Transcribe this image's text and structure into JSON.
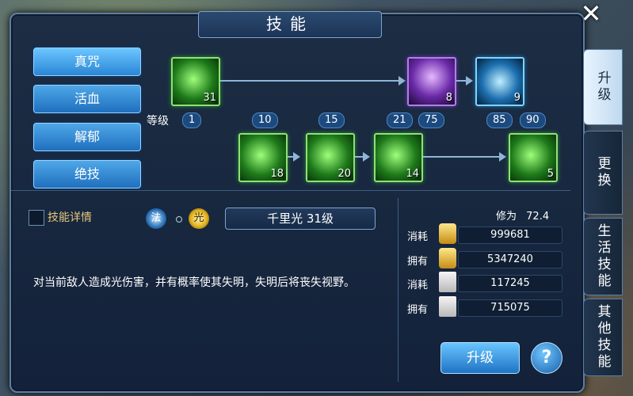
{
  "window": {
    "title": "技能",
    "close_label": "✕"
  },
  "menu": [
    {
      "label": "真咒",
      "active": true
    },
    {
      "label": "活血",
      "active": false
    },
    {
      "label": "解郁",
      "active": false
    },
    {
      "label": "绝技",
      "active": false
    }
  ],
  "side_tabs": [
    {
      "label": "升级",
      "active": true
    },
    {
      "label": "更换",
      "active": false
    },
    {
      "label": "生活技能",
      "active": false
    },
    {
      "label": "其他技能",
      "active": false
    }
  ],
  "skill_tree": {
    "level_label": "等级",
    "levels": [
      "1",
      "10",
      "15",
      "21",
      "75",
      "85",
      "90"
    ],
    "top_row": [
      {
        "icon": "claw-skill-icon",
        "level": "31"
      },
      {
        "icon": "purple-flame-skill-icon",
        "level": "8"
      },
      {
        "icon": "blue-hand-skill-icon",
        "level": "9"
      }
    ],
    "bottom_row": [
      {
        "icon": "leaf-skill-icon",
        "level": "18"
      },
      {
        "icon": "green-orb-skill-icon",
        "level": "20"
      },
      {
        "icon": "green-swirl-skill-icon",
        "level": "14"
      },
      {
        "icon": "green-wave-skill-icon",
        "level": "5"
      }
    ]
  },
  "details": {
    "label": "技能详情",
    "school_emblem": "法",
    "element_emblem": "光",
    "skill_name": "千里光 31级",
    "description": "对当前敌人造成光伤害，并有概率使其失明，失明后将丧失视野。"
  },
  "resources": {
    "cultivation_label": "修为",
    "cultivation_value": "72.4",
    "rows": [
      {
        "label": "消耗",
        "icon": "gold-exp-icon",
        "value": "999681"
      },
      {
        "label": "拥有",
        "icon": "gold-exp-icon",
        "value": "5347240"
      },
      {
        "label": "消耗",
        "icon": "scroll-icon",
        "value": "117245"
      },
      {
        "label": "拥有",
        "icon": "scroll-icon",
        "value": "715075"
      }
    ]
  },
  "actions": {
    "upgrade_label": "升级",
    "help_label": "?"
  }
}
